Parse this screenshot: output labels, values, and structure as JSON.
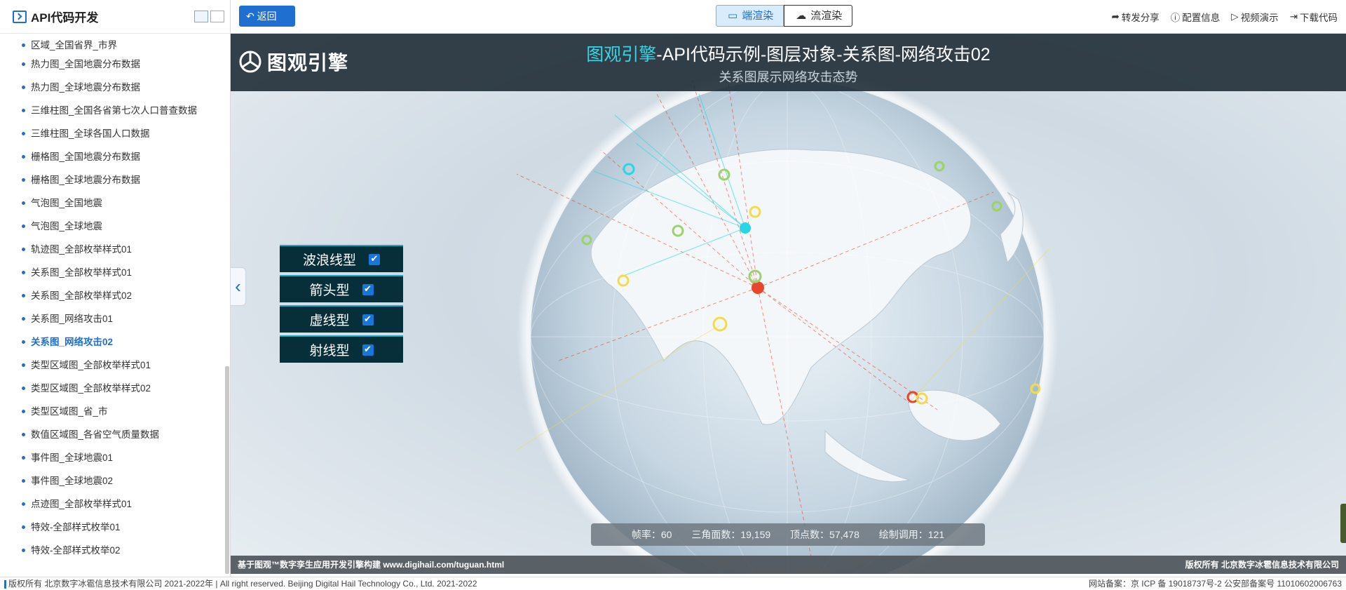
{
  "sidebar": {
    "title": "API代码开发",
    "items": [
      {
        "label": "区域_全国省界_市界"
      },
      {
        "label": "热力图_全国地震分布数据"
      },
      {
        "label": "热力图_全球地震分布数据"
      },
      {
        "label": "三维柱图_全国各省第七次人口普查数据"
      },
      {
        "label": "三维柱图_全球各国人口数据"
      },
      {
        "label": "栅格图_全国地震分布数据"
      },
      {
        "label": "栅格图_全球地震分布数据"
      },
      {
        "label": "气泡图_全国地震"
      },
      {
        "label": "气泡图_全球地震"
      },
      {
        "label": "轨迹图_全部枚举样式01"
      },
      {
        "label": "关系图_全部枚举样式01"
      },
      {
        "label": "关系图_全部枚举样式02"
      },
      {
        "label": "关系图_网络攻击01"
      },
      {
        "label": "关系图_网络攻击02"
      },
      {
        "label": "类型区域图_全部枚举样式01"
      },
      {
        "label": "类型区域图_全部枚举样式02"
      },
      {
        "label": "类型区域图_省_市"
      },
      {
        "label": "数值区域图_各省空气质量数据"
      },
      {
        "label": "事件图_全球地震01"
      },
      {
        "label": "事件图_全球地震02"
      },
      {
        "label": "点迹图_全部枚举样式01"
      },
      {
        "label": "特效-全部样式枚举01"
      },
      {
        "label": "特效-全部样式枚举02"
      }
    ],
    "active_label": "关系图_网络攻击02"
  },
  "topbar": {
    "back_label": "返回",
    "render_client_label": "端渲染",
    "render_stream_label": "流渲染",
    "share_label": "转发分享",
    "config_label": "配置信息",
    "video_label": "视频演示",
    "download_label": "下载代码"
  },
  "scene": {
    "logo_text": "图观引擎",
    "title_brand": "图观引擎",
    "title_rest": "-API代码示例-图层对象-关系图-网络攻击02",
    "subtitle": "关系图展示网络攻击态势",
    "line_types": [
      {
        "label": "波浪线型",
        "checked": true
      },
      {
        "label": "箭头型",
        "checked": true
      },
      {
        "label": "虚线型",
        "checked": true
      },
      {
        "label": "射线型",
        "checked": true
      }
    ],
    "stats": {
      "fps": "帧率：60",
      "triangles": "三角面数：19,159",
      "vertices": "顶点数：57,478",
      "draw_calls": "绘制调用：121"
    },
    "footer_left": "基于图观™数字孪生应用开发引擎构建 www.digihail.com/tuguan.html",
    "footer_right": "版权所有 北京数字冰雹信息技术有限公司"
  },
  "page_footer": {
    "copyright": "版权所有 北京数字冰雹信息技术有限公司 2021-2022年 | All right reserved. Beijing Digital Hail Technology Co., Ltd. 2021-2022",
    "icp": "网站备案：京 ICP 备 19018737号-2 公安部备案号 11010602006763"
  },
  "colors": {
    "accent": "#1f6fd1",
    "attack_red": "#e8452c",
    "attack_cyan": "#2ad6e6",
    "node_yellow": "#f3dc4a",
    "node_green": "#9bd36a"
  }
}
